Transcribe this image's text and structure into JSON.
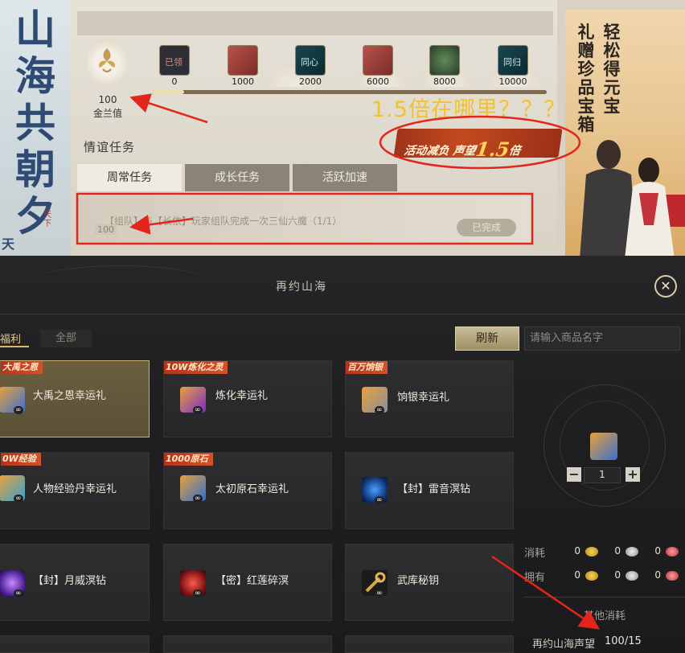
{
  "left_banner": {
    "calligraphy": "山海共朝夕",
    "sub_a": "天",
    "sub_b": "天下"
  },
  "friendship": {
    "value": "100",
    "label": "金兰值"
  },
  "milestones": [
    {
      "threshold": "0",
      "icon": "claimed-chest-icon",
      "status": "已领"
    },
    {
      "threshold": "1000",
      "icon": "red-chest-icon",
      "status": ""
    },
    {
      "threshold": "2000",
      "icon": "tongxin-token-icon",
      "status": "同心"
    },
    {
      "threshold": "6000",
      "icon": "red-chest-icon",
      "status": ""
    },
    {
      "threshold": "8000",
      "icon": "jade-pendant-icon",
      "status": ""
    },
    {
      "threshold": "10000",
      "icon": "tonggui-token-icon",
      "status": "同归"
    }
  ],
  "progress_fraction": 0.01,
  "section_title": "情谊任务",
  "activity_badge": {
    "prefix": "活动减负 声望",
    "multiplier": "1.5",
    "suffix": "倍"
  },
  "tabs": [
    "周常任务",
    "成长任务",
    "活跃加速"
  ],
  "task": {
    "text": "【组队】与【长依】玩家组队完成一次三仙六魔（1/1）",
    "points": "100",
    "status": "已完成"
  },
  "right_art": {
    "col1": "轻松得元宝",
    "col2": "礼赠珍品宝箱"
  },
  "annotation": {
    "question": "1.5倍在哪里？？？",
    "colors": {
      "annotation_red": "#e3251b",
      "annotation_yellow": "#f2c12c"
    }
  },
  "dialog": {
    "title": "再约山海",
    "close_icon": "close-icon",
    "filter_tabs": {
      "welfare": "福利",
      "all": "全部"
    },
    "refresh_label": "刷新",
    "search_placeholder": "请输入商品名字",
    "cards": [
      {
        "tag": "大禹之恩",
        "name": "大禹之恩幸运礼",
        "icon": "gift-bag-icon"
      },
      {
        "tag": "10W炼化之灵",
        "name": "炼化幸运礼",
        "icon": "gift-bag-icon"
      },
      {
        "tag": "百万饷银",
        "name": "饷银幸运礼",
        "icon": "gift-bag-icon"
      },
      {
        "tag": "0W经验",
        "name": "人物经验丹幸运礼",
        "icon": "gift-bag-icon"
      },
      {
        "tag": "1000原石",
        "name": "太初原石幸运礼",
        "icon": "gift-bag-icon"
      },
      {
        "tag": "",
        "name": "【封】雷音溟钻",
        "icon": "blue-gem-icon"
      },
      {
        "tag": "",
        "name": "【封】月威溟钻",
        "icon": "purple-gem-icon"
      },
      {
        "tag": "",
        "name": "【密】红莲碎溟",
        "icon": "red-shard-icon"
      },
      {
        "tag": "",
        "name": "武库秘钥",
        "icon": "key-icon"
      }
    ],
    "infinity": "∞",
    "detail": {
      "quantity": "1",
      "minus": "−",
      "plus": "+",
      "cost_label": "消耗",
      "own_label": "拥有",
      "cost_values": [
        "0",
        "0",
        "0"
      ],
      "own_values": [
        "0",
        "0",
        "0"
      ],
      "coins": [
        "gold-coin-icon",
        "silver-coin-icon",
        "red-coin-icon"
      ],
      "other_cost_title": "其他消耗",
      "reputation_label": "再约山海声望",
      "reputation_value": "100/15"
    }
  }
}
